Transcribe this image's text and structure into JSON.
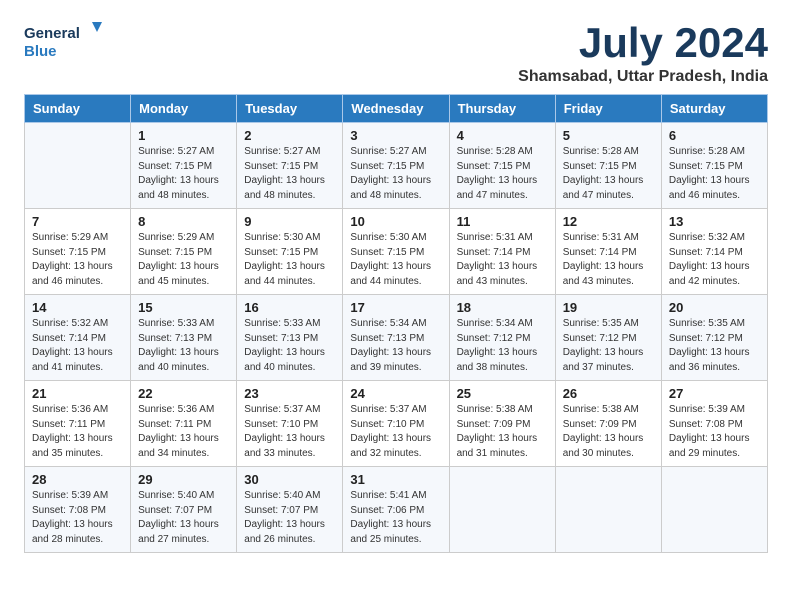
{
  "logo": {
    "line1": "General",
    "line2": "Blue"
  },
  "title": "July 2024",
  "location": "Shamsabad, Uttar Pradesh, India",
  "headers": [
    "Sunday",
    "Monday",
    "Tuesday",
    "Wednesday",
    "Thursday",
    "Friday",
    "Saturday"
  ],
  "weeks": [
    [
      {
        "day": "",
        "info": ""
      },
      {
        "day": "1",
        "info": "Sunrise: 5:27 AM\nSunset: 7:15 PM\nDaylight: 13 hours and 48 minutes."
      },
      {
        "day": "2",
        "info": "Sunrise: 5:27 AM\nSunset: 7:15 PM\nDaylight: 13 hours and 48 minutes."
      },
      {
        "day": "3",
        "info": "Sunrise: 5:27 AM\nSunset: 7:15 PM\nDaylight: 13 hours and 48 minutes."
      },
      {
        "day": "4",
        "info": "Sunrise: 5:28 AM\nSunset: 7:15 PM\nDaylight: 13 hours and 47 minutes."
      },
      {
        "day": "5",
        "info": "Sunrise: 5:28 AM\nSunset: 7:15 PM\nDaylight: 13 hours and 47 minutes."
      },
      {
        "day": "6",
        "info": "Sunrise: 5:28 AM\nSunset: 7:15 PM\nDaylight: 13 hours and 46 minutes."
      }
    ],
    [
      {
        "day": "7",
        "info": "Sunrise: 5:29 AM\nSunset: 7:15 PM\nDaylight: 13 hours and 46 minutes."
      },
      {
        "day": "8",
        "info": "Sunrise: 5:29 AM\nSunset: 7:15 PM\nDaylight: 13 hours and 45 minutes."
      },
      {
        "day": "9",
        "info": "Sunrise: 5:30 AM\nSunset: 7:15 PM\nDaylight: 13 hours and 44 minutes."
      },
      {
        "day": "10",
        "info": "Sunrise: 5:30 AM\nSunset: 7:15 PM\nDaylight: 13 hours and 44 minutes."
      },
      {
        "day": "11",
        "info": "Sunrise: 5:31 AM\nSunset: 7:14 PM\nDaylight: 13 hours and 43 minutes."
      },
      {
        "day": "12",
        "info": "Sunrise: 5:31 AM\nSunset: 7:14 PM\nDaylight: 13 hours and 43 minutes."
      },
      {
        "day": "13",
        "info": "Sunrise: 5:32 AM\nSunset: 7:14 PM\nDaylight: 13 hours and 42 minutes."
      }
    ],
    [
      {
        "day": "14",
        "info": "Sunrise: 5:32 AM\nSunset: 7:14 PM\nDaylight: 13 hours and 41 minutes."
      },
      {
        "day": "15",
        "info": "Sunrise: 5:33 AM\nSunset: 7:13 PM\nDaylight: 13 hours and 40 minutes."
      },
      {
        "day": "16",
        "info": "Sunrise: 5:33 AM\nSunset: 7:13 PM\nDaylight: 13 hours and 40 minutes."
      },
      {
        "day": "17",
        "info": "Sunrise: 5:34 AM\nSunset: 7:13 PM\nDaylight: 13 hours and 39 minutes."
      },
      {
        "day": "18",
        "info": "Sunrise: 5:34 AM\nSunset: 7:12 PM\nDaylight: 13 hours and 38 minutes."
      },
      {
        "day": "19",
        "info": "Sunrise: 5:35 AM\nSunset: 7:12 PM\nDaylight: 13 hours and 37 minutes."
      },
      {
        "day": "20",
        "info": "Sunrise: 5:35 AM\nSunset: 7:12 PM\nDaylight: 13 hours and 36 minutes."
      }
    ],
    [
      {
        "day": "21",
        "info": "Sunrise: 5:36 AM\nSunset: 7:11 PM\nDaylight: 13 hours and 35 minutes."
      },
      {
        "day": "22",
        "info": "Sunrise: 5:36 AM\nSunset: 7:11 PM\nDaylight: 13 hours and 34 minutes."
      },
      {
        "day": "23",
        "info": "Sunrise: 5:37 AM\nSunset: 7:10 PM\nDaylight: 13 hours and 33 minutes."
      },
      {
        "day": "24",
        "info": "Sunrise: 5:37 AM\nSunset: 7:10 PM\nDaylight: 13 hours and 32 minutes."
      },
      {
        "day": "25",
        "info": "Sunrise: 5:38 AM\nSunset: 7:09 PM\nDaylight: 13 hours and 31 minutes."
      },
      {
        "day": "26",
        "info": "Sunrise: 5:38 AM\nSunset: 7:09 PM\nDaylight: 13 hours and 30 minutes."
      },
      {
        "day": "27",
        "info": "Sunrise: 5:39 AM\nSunset: 7:08 PM\nDaylight: 13 hours and 29 minutes."
      }
    ],
    [
      {
        "day": "28",
        "info": "Sunrise: 5:39 AM\nSunset: 7:08 PM\nDaylight: 13 hours and 28 minutes."
      },
      {
        "day": "29",
        "info": "Sunrise: 5:40 AM\nSunset: 7:07 PM\nDaylight: 13 hours and 27 minutes."
      },
      {
        "day": "30",
        "info": "Sunrise: 5:40 AM\nSunset: 7:07 PM\nDaylight: 13 hours and 26 minutes."
      },
      {
        "day": "31",
        "info": "Sunrise: 5:41 AM\nSunset: 7:06 PM\nDaylight: 13 hours and 25 minutes."
      },
      {
        "day": "",
        "info": ""
      },
      {
        "day": "",
        "info": ""
      },
      {
        "day": "",
        "info": ""
      }
    ]
  ]
}
